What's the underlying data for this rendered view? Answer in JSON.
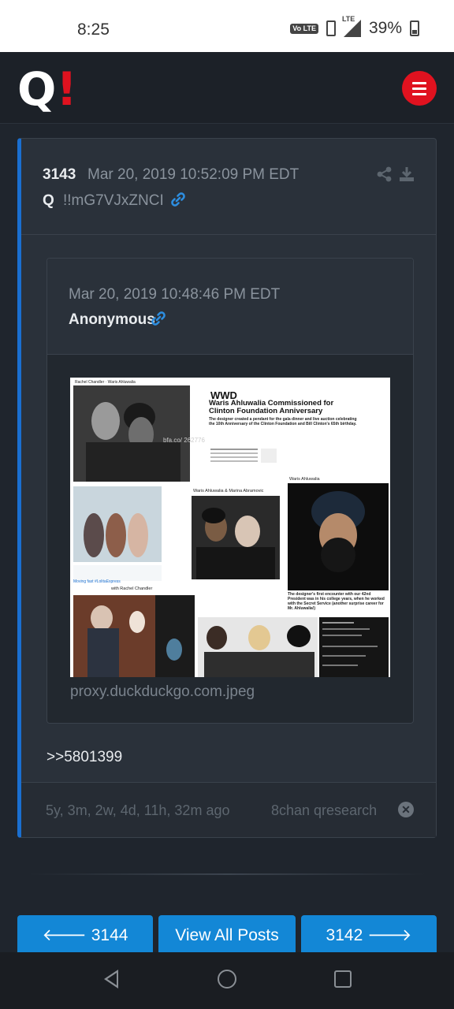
{
  "status_bar": {
    "time": "8:25",
    "volte": "Vo LTE",
    "lte": "LTE",
    "battery": "39%"
  },
  "header": {
    "logo_q": "Q",
    "logo_excl": "!",
    "brand_red": "#e0121f"
  },
  "post": {
    "number": "3143",
    "date": "Mar 20, 2019 10:52:09 PM EDT",
    "author": "Q",
    "tripcode": "!!mG7VJxZNCI",
    "quote": {
      "date": "Mar 20, 2019 10:48:46 PM EDT",
      "name": "Anonymous",
      "image_caption": "proxy.duckduckgo.com.jpeg",
      "collage": {
        "header_names": "Rachel Chandler · Waris Ahluwalia",
        "wwd_logo": "WWD",
        "headline": "Waris Ahluwalia Commissioned for Clinton Foundation Anniversary",
        "subhead": "The designer created a pendant for the gala dinner and live auction celebrating the 10th Anniversary of the Clinton Foundation and Bill Clinton's 65th birthday.",
        "label_marina": "Waris Ahluwalia & Marina Abramovic",
        "label_waris": "Waris Ahluwalia",
        "label_rachel": "with Rachel Chandler",
        "moving_fast": "Moving fast #LolitaExpress",
        "overlay": "bfa.co/ 262776",
        "secret_service": "The designer's first encounter with our 42nd President was in his college years, when he worked with the Secret Service (another surprise career for Mr. Ahluwalia!)"
      }
    },
    "reference": ">>5801399",
    "ago": "5y, 3m, 2w, 4d, 11h, 32m ago",
    "source": "8chan qresearch"
  },
  "nav": {
    "prev_label": "3144",
    "all_label": "View All Posts",
    "next_label": "3142"
  },
  "colors": {
    "accent_blue": "#1387d6",
    "card_border": "#1a6fd0",
    "link": "#2d8ee0"
  }
}
